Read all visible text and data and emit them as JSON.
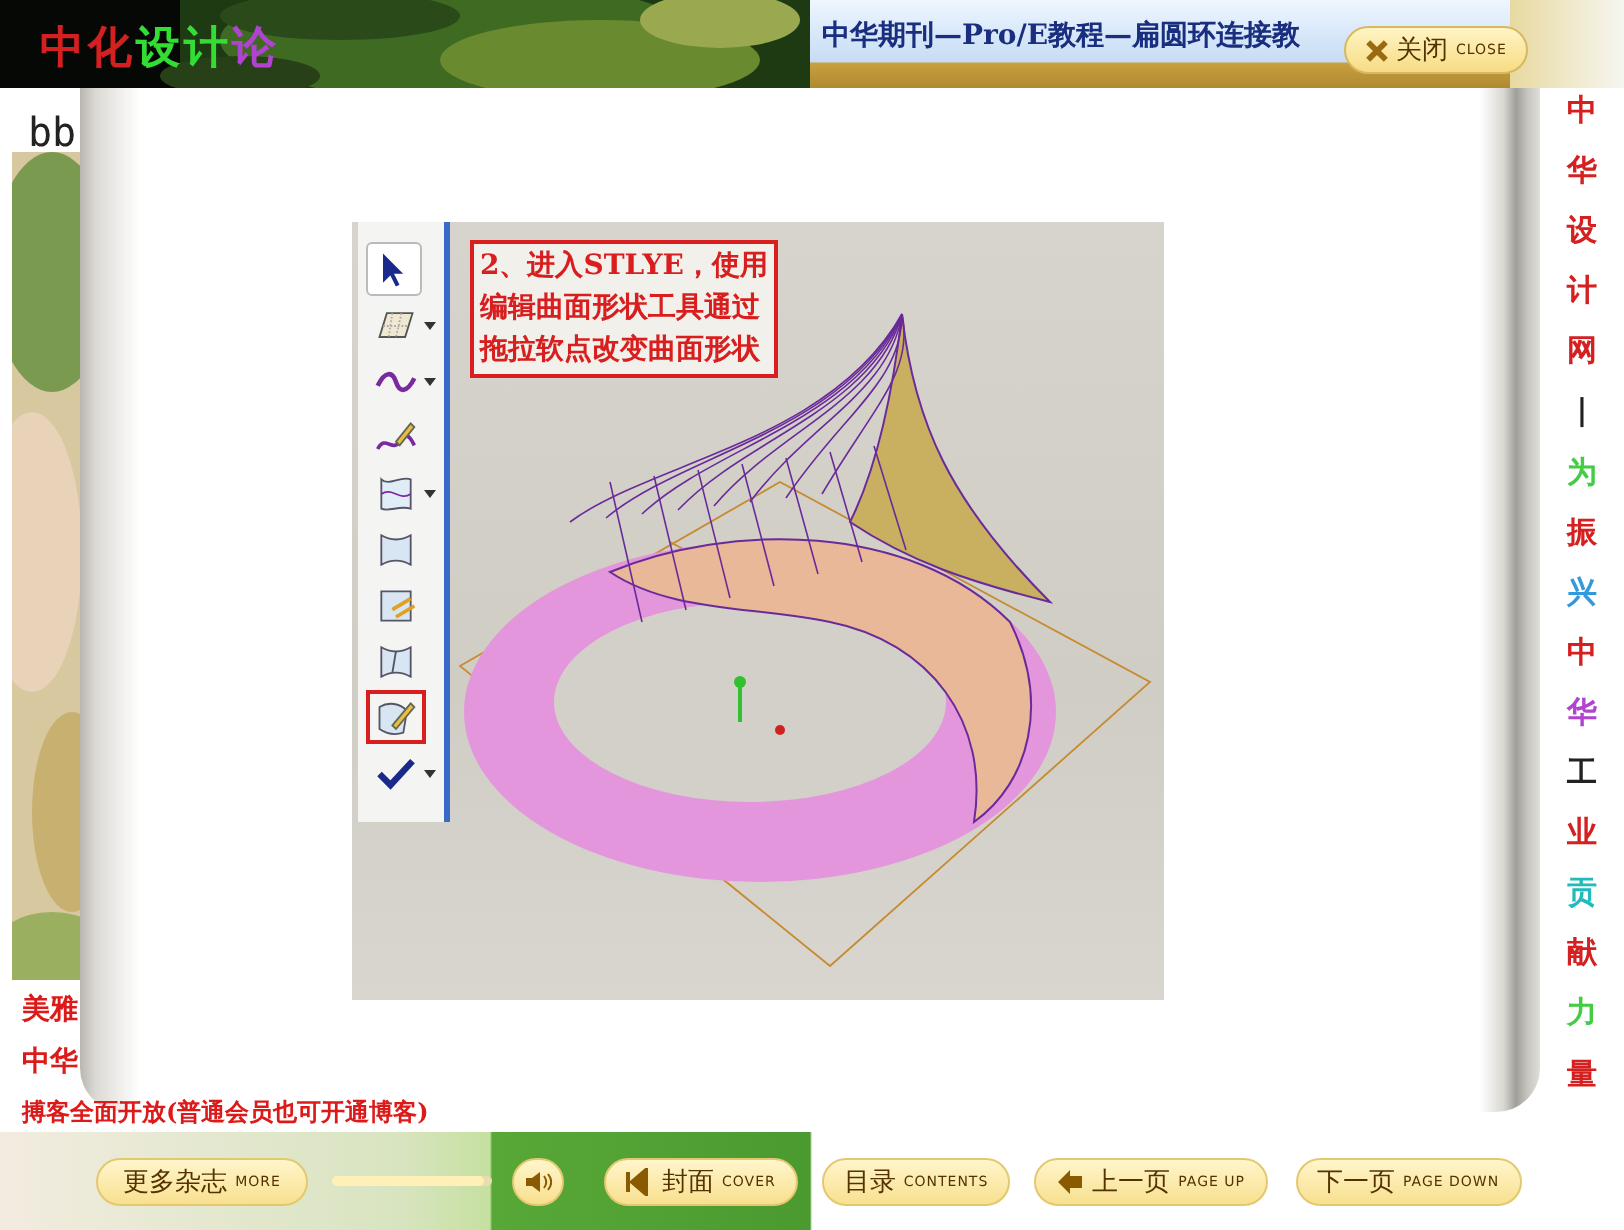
{
  "header": {
    "logo": [
      {
        "text": "中",
        "color": "#d42020"
      },
      {
        "text": "化",
        "color": "#d42020"
      },
      {
        "text": "设",
        "color": "#33dd33"
      },
      {
        "text": "计",
        "color": "#33dd33"
      },
      {
        "text": "论",
        "color": "#b044d0"
      }
    ],
    "logo_subtitle": "bb",
    "title": "中华期刊—Pro/E教程—扁圆环连接教",
    "close_button": {
      "label": "关闭",
      "label_en": "CLOSE"
    }
  },
  "left_notes": [
    "美雅",
    "中华",
    "搏客全面开放(普通会员也可开通博客)"
  ],
  "side_banner": [
    {
      "text": "中",
      "color": "#d42020"
    },
    {
      "text": "华",
      "color": "#d42020"
    },
    {
      "text": "设",
      "color": "#d42020"
    },
    {
      "text": "计",
      "color": "#d42020"
    },
    {
      "text": "网",
      "color": "#d42020"
    },
    {
      "text": "|",
      "color": "#222222"
    },
    {
      "text": "为",
      "color": "#44cc44"
    },
    {
      "text": "振",
      "color": "#d42020"
    },
    {
      "text": "兴",
      "color": "#3399dd"
    },
    {
      "text": "中",
      "color": "#d42020"
    },
    {
      "text": "华",
      "color": "#b044d0"
    },
    {
      "text": "工",
      "color": "#222222"
    },
    {
      "text": "业",
      "color": "#d42020"
    },
    {
      "text": "贡",
      "color": "#22bbbb"
    },
    {
      "text": "献",
      "color": "#d42020"
    },
    {
      "text": "力",
      "color": "#44cc44"
    },
    {
      "text": "量",
      "color": "#d42020"
    }
  ],
  "page": {
    "caption": [
      "2、进入STLYE，使用",
      "编辑曲面形状工具通过",
      "拖拉软点改变曲面形状"
    ],
    "tools": [
      {
        "kind": "select",
        "dropdown": false,
        "selected": false
      },
      {
        "kind": "surface",
        "dropdown": true,
        "selected": false
      },
      {
        "kind": "curve",
        "dropdown": true,
        "selected": false
      },
      {
        "kind": "sketch",
        "dropdown": false,
        "selected": false
      },
      {
        "kind": "blend",
        "dropdown": true,
        "selected": false
      },
      {
        "kind": "patch",
        "dropdown": false,
        "selected": false
      },
      {
        "kind": "trim",
        "dropdown": false,
        "selected": false
      },
      {
        "kind": "split",
        "dropdown": false,
        "selected": false
      },
      {
        "kind": "edit",
        "dropdown": false,
        "selected": true
      },
      {
        "kind": "done",
        "dropdown": true,
        "selected": false
      }
    ]
  },
  "controls": {
    "more": {
      "label": "更多杂志",
      "label_en": "MORE"
    },
    "volume": {
      "level": 0.95
    },
    "buttons": [
      {
        "kind": "cover",
        "label": "封面",
        "label_en": "COVER"
      },
      {
        "kind": "contents",
        "label": "目录",
        "label_en": "CONTENTS"
      },
      {
        "kind": "prev",
        "label": "上一页",
        "label_en": "PAGE UP"
      },
      {
        "kind": "next",
        "label": "下一页",
        "label_en": "PAGE DOWN"
      }
    ]
  }
}
